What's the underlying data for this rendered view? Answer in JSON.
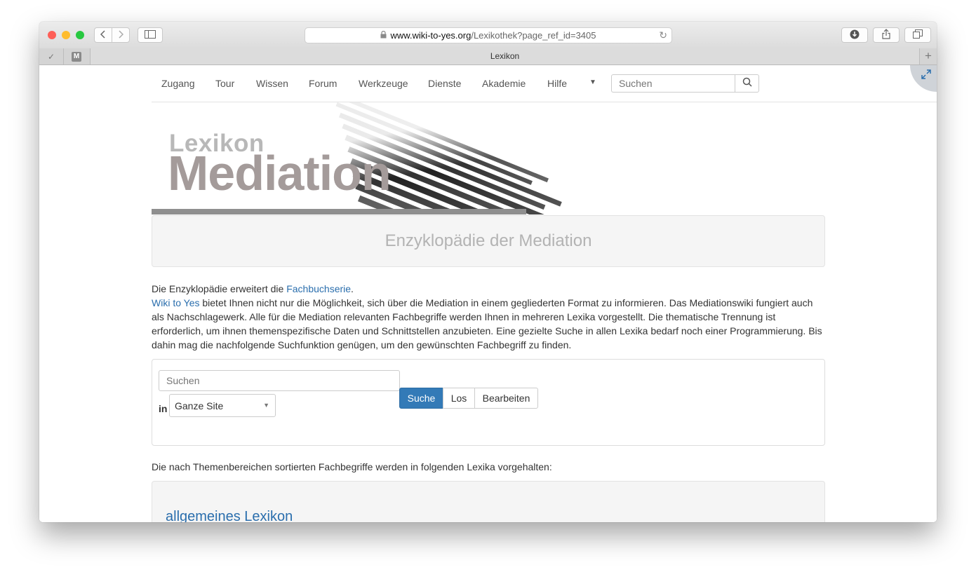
{
  "browser": {
    "url_host": "www.wiki-to-yes.org",
    "url_path": "/Lexikothek?page_ref_id=3405",
    "tab_title": "Lexikon",
    "tab_icon_letter": "M",
    "traffic_colors": [
      "#fe5f57",
      "#febc2e",
      "#28c840"
    ]
  },
  "nav": {
    "items": [
      "Zugang",
      "Tour",
      "Wissen",
      "Forum",
      "Werkzeuge",
      "Dienste",
      "Akademie",
      "Hilfe"
    ],
    "search_placeholder": "Suchen"
  },
  "banner": {
    "small_text": "Lexikon",
    "big_text": "Mediation"
  },
  "jumbotron": {
    "title": "Enzyklopädie der Mediation"
  },
  "intro": {
    "line1_prefix": "Die Enzyklopädie erweitert die ",
    "line1_link": "Fachbuchserie",
    "line1_suffix": ".",
    "para_link": "Wiki to Yes",
    "para_text": " bietet Ihnen nicht nur die Möglichkeit, sich über die Mediation in einem gegliederten Format zu informieren. Das Mediationswiki fungiert auch als Nachschlagewerk. Alle für die Mediation relevanten Fachbegriffe werden Ihnen in mehreren Lexika vorgestellt. Die thematische Trennung ist erforderlich, um ihnen themenspezifische Daten und Schnittstellen anzubieten. Eine gezielte Suche in allen Lexika bedarf noch einer Programmierung. Bis dahin mag die nachfolgende Suchfunktion genügen, um den gewünschten Fachbegriff zu finden."
  },
  "search_form": {
    "placeholder": "Suchen",
    "in_label": "in",
    "scope": "Ganze Site",
    "buttons": [
      "Suche",
      "Los",
      "Bearbeiten"
    ]
  },
  "lexika": {
    "intro": "Die nach Themenbereichen sortierten Fachbegriffe werden in folgenden Lexika vorgehalten:",
    "first_title": "allgemeines Lexikon"
  }
}
